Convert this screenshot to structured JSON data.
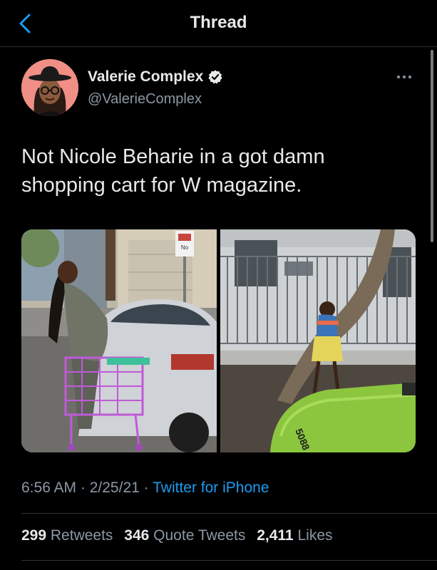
{
  "header": {
    "title": "Thread"
  },
  "tweet": {
    "display_name": "Valerie Complex",
    "handle": "@ValerieComplex",
    "text": "Not Nicole Beharie in a got damn shopping cart for W magazine.",
    "time": "6:56 AM",
    "date": "2/25/21",
    "source": "Twitter for iPhone",
    "stats": {
      "retweets_count": "299",
      "retweets_label": "Retweets",
      "quotes_count": "346",
      "quotes_label": "Quote Tweets",
      "likes_count": "2,411",
      "likes_label": "Likes"
    }
  },
  "media": {
    "left_sign_text": "No",
    "right_car_text": "5088"
  },
  "colors": {
    "accent": "#1d9bf0",
    "background": "#000000",
    "secondary_text": "#8b98a5"
  }
}
